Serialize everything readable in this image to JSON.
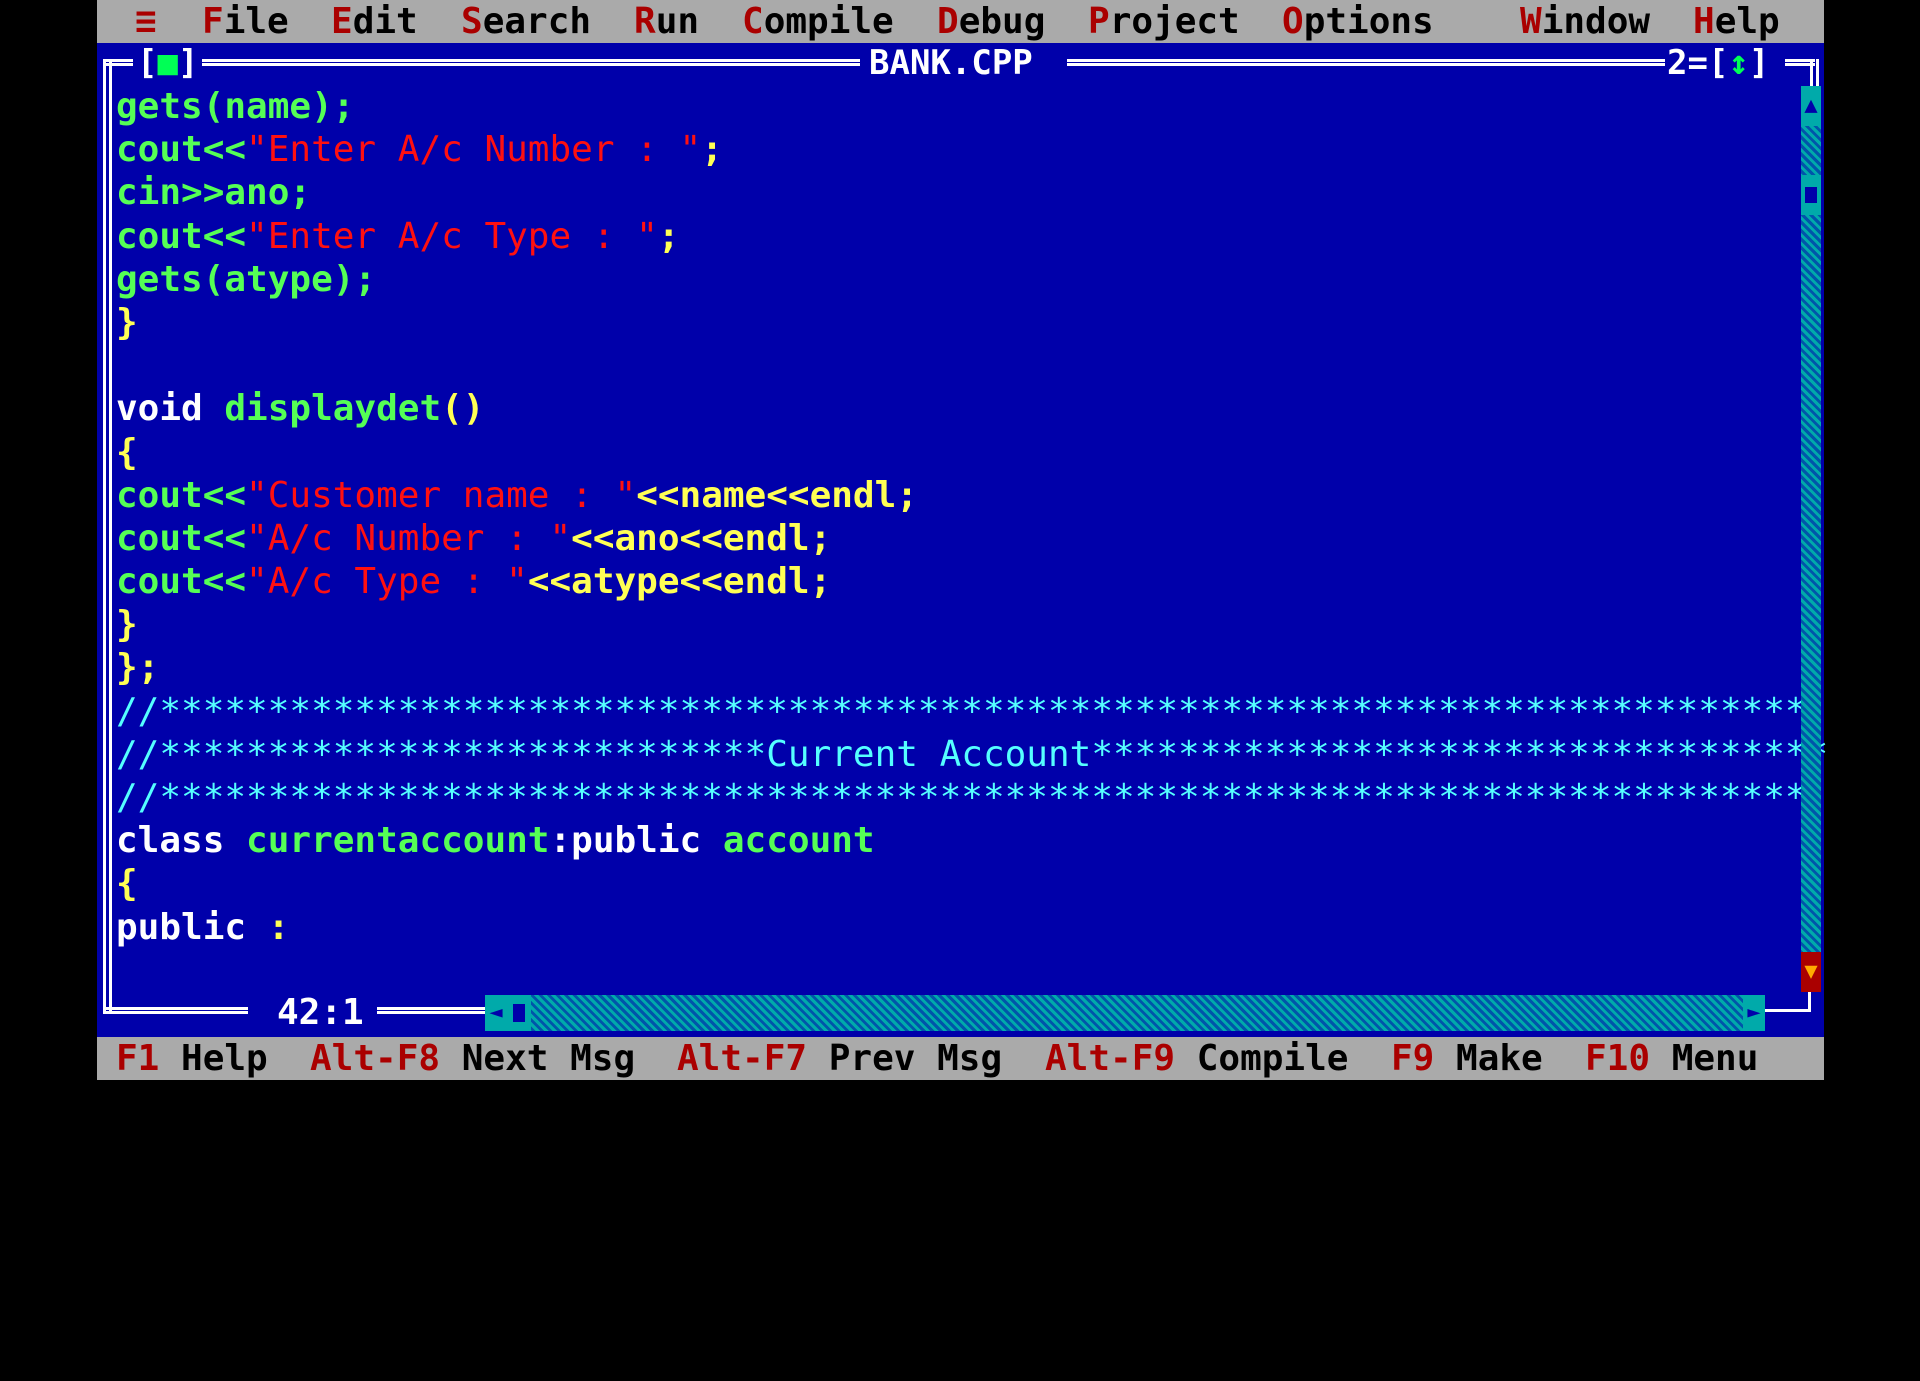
{
  "menu": {
    "system": "≡",
    "items": [
      {
        "hotkey": "F",
        "rest": "ile"
      },
      {
        "hotkey": "E",
        "rest": "dit"
      },
      {
        "hotkey": "S",
        "rest": "earch"
      },
      {
        "hotkey": "R",
        "rest": "un"
      },
      {
        "hotkey": "C",
        "rest": "ompile"
      },
      {
        "hotkey": "D",
        "rest": "ebug"
      },
      {
        "hotkey": "P",
        "rest": "roject"
      },
      {
        "hotkey": "O",
        "rest": "ptions"
      },
      {
        "hotkey": "W",
        "rest": "indow"
      },
      {
        "hotkey": "H",
        "rest": "elp"
      }
    ]
  },
  "window": {
    "title": "BANK.CPP",
    "close_left": "[",
    "close_glyph": "■",
    "close_right": "]",
    "number": "2",
    "zoom_left": "=[",
    "zoom_glyph": "↕",
    "zoom_right": "]",
    "cursor_pos": "42:1"
  },
  "code": {
    "l1": {
      "a": "gets(name);"
    },
    "l2": {
      "a": "cout<<",
      "b": "\"Enter A/c Number : \"",
      "c": ";"
    },
    "l3": {
      "a": "cin>>ano;"
    },
    "l4": {
      "a": "cout<<",
      "b": "\"Enter A/c Type : \"",
      "c": ";"
    },
    "l5": {
      "a": "gets(atype);"
    },
    "l6": {
      "a": "}"
    },
    "l7": {
      "a": ""
    },
    "l8": {
      "a": "void",
      "b": " displaydet",
      "c": "()"
    },
    "l9": {
      "a": "{"
    },
    "l10": {
      "a": "cout<<",
      "b": "\"Customer name : \"",
      "c": "<<name<<endl;"
    },
    "l11": {
      "a": "cout<<",
      "b": "\"A/c Number : \"",
      "c": "<<ano<<endl;"
    },
    "l12": {
      "a": "cout<<",
      "b": "\"A/c Type : \"",
      "c": "<<atype<<endl;"
    },
    "l13": {
      "a": "}"
    },
    "l14": {
      "a": "};"
    },
    "l15": {
      "a": "//****************************************************************************"
    },
    "l16": {
      "a": "//****************************Current Account**********************************"
    },
    "l17": {
      "a": "//****************************************************************************"
    },
    "l18": {
      "a": "class",
      "b": " currentaccount",
      "c": ":public",
      "d": " account"
    },
    "l19": {
      "a": "{"
    },
    "l20": {
      "a": "public",
      "b": " :"
    }
  },
  "scrollbar": {
    "up": "▲",
    "down": "▼",
    "left": "◄",
    "right": "►"
  },
  "status": {
    "items": [
      {
        "key": "F1",
        "label": " Help"
      },
      {
        "key": "Alt-F8",
        "label": " Next Msg"
      },
      {
        "key": "Alt-F7",
        "label": " Prev Msg"
      },
      {
        "key": "Alt-F9",
        "label": " Compile"
      },
      {
        "key": "F9",
        "label": " Make"
      },
      {
        "key": "F10",
        "label": " Menu"
      }
    ]
  },
  "colors": {
    "background": "#0000aa",
    "menubar": "#aaaaaa",
    "hotkey": "#aa0000",
    "identifier": "#55ff55",
    "punctuation": "#ffff55",
    "string": "#ff1010",
    "comment": "#55ffff",
    "keyword": "#ffffff"
  }
}
